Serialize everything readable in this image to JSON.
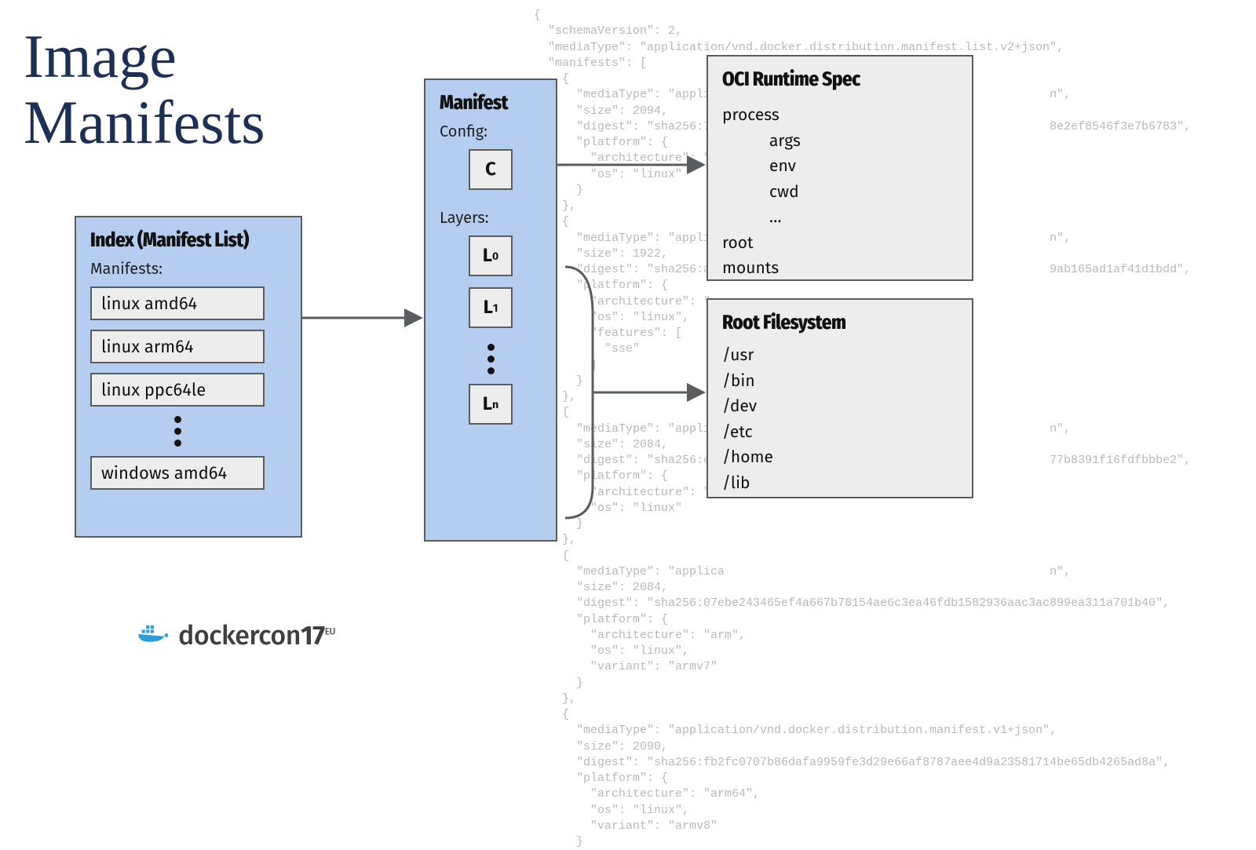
{
  "title_line1": "Image",
  "title_line2": "Manifests",
  "index_box": {
    "title": "Index (Manifest List)",
    "subtitle": "Manifests:",
    "items": [
      "linux amd64",
      "linux arm64",
      "linux ppc64le",
      "windows amd64"
    ]
  },
  "manifest_box": {
    "title": "Manifest",
    "config_label": "Config:",
    "config_chip": "C",
    "layers_label": "Layers:",
    "layer_chips": [
      "L0",
      "L1",
      "Ln"
    ]
  },
  "oci_box": {
    "title": "OCI Runtime Spec",
    "lines": [
      {
        "text": "process",
        "indent": 0
      },
      {
        "text": "args",
        "indent": 1
      },
      {
        "text": "env",
        "indent": 1
      },
      {
        "text": "cwd",
        "indent": 1
      },
      {
        "text": "…",
        "indent": 1
      },
      {
        "text": "root",
        "indent": 0
      },
      {
        "text": "mounts",
        "indent": 0
      }
    ]
  },
  "rootfs_box": {
    "title": "Root Filesystem",
    "lines": [
      "/usr",
      "/bin",
      "/dev",
      "/etc",
      "/home",
      "/lib"
    ]
  },
  "code_bg": "{\n  \"schemaVersion\": 2,\n  \"mediaType\": \"application/vnd.docker.distribution.manifest.list.v2+json\",\n  \"manifests\": [\n    {\n      \"mediaType\": \"applica                                              n\",\n      \"size\": 2094,\n      \"digest\": \"sha256:782                                              8e2ef8546f3e7b6783\",\n      \"platform\": {\n        \"architecture\": \"p\n        \"os\": \"linux\"\n      }\n    },\n    {\n      \"mediaType\": \"applica                                              n\",\n      \"size\": 1922,\n      \"digest\": \"sha256:ae1                                              9ab165ad1af41d1bdd\",\n      \"platform\": {\n        \"architecture\": \"a\n        \"os\": \"linux\",\n        \"features\": [\n          \"sse\"\n        ]\n      }\n    },\n    {\n      \"mediaType\": \"applica                                              n\",\n      \"size\": 2084,\n      \"digest\": \"sha256:e4c                                              77b8391f16fdfbbbe2\",\n      \"platform\": {\n        \"architecture\": \"s\n        \"os\": \"linux\"\n      }\n    },\n    {\n      \"mediaType\": \"applica                                              n\",\n      \"size\": 2084,\n      \"digest\": \"sha256:07ebe243465ef4a667b78154ae6c3ea46fdb1582936aac3ac899ea311a701b40\",\n      \"platform\": {\n        \"architecture\": \"arm\",\n        \"os\": \"linux\",\n        \"variant\": \"armv7\"\n      }\n    },\n    {\n      \"mediaType\": \"application/vnd.docker.distribution.manifest.v1+json\",\n      \"size\": 2090,\n      \"digest\": \"sha256:fb2fc0707b86dafa9959fe3d29e66af8787aee4d9a23581714be65db4265ad8a\",\n      \"platform\": {\n        \"architecture\": \"arm64\",\n        \"os\": \"linux\",\n        \"variant\": \"armv8\"\n      }",
  "logo": {
    "text": "dockercon",
    "suffix": "17",
    "badge": "EU"
  }
}
